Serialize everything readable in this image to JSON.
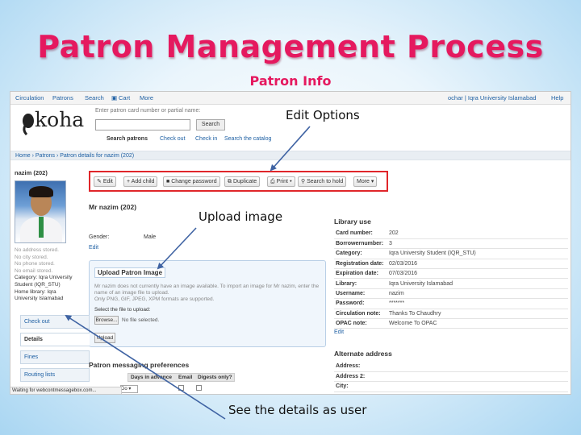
{
  "slide": {
    "title": "Patron Management Process",
    "subtitle": "Patron Info"
  },
  "annotations": {
    "edit_options": "Edit Options",
    "upload_image": "Upload image",
    "see_details": "See the details as user"
  },
  "app": {
    "nav": {
      "items": [
        "Circulation",
        "Patrons",
        "Search",
        "Cart",
        "More"
      ],
      "user": "ochar | Iqra University Islamabad",
      "help": "Help"
    },
    "logo_text": "koha",
    "search": {
      "hint": "Enter patron card number or partial name:",
      "submit_label": "Search",
      "tabs": [
        "Search patrons",
        "Check out",
        "Check in",
        "Search the catalog"
      ]
    },
    "breadcrumb": "Home › Patrons › Patron details for nazim (202)",
    "patron_heading": "nazim (202)",
    "toolbar": [
      "Edit",
      "Add child",
      "Change password",
      "Duplicate",
      "Print",
      "Search to hold",
      "More"
    ],
    "patron_name": "Mr nazim (202)",
    "left_info": [
      "No address stored.",
      "No city stored.",
      "No phone stored.",
      "No email stored.",
      "Category: Iqra University",
      "Student (IQR_STU)",
      "Home library: Iqra",
      "University Islamabad"
    ],
    "gender_label": "Gender:",
    "gender_value": "Male",
    "edit_label": "Edit",
    "upload": {
      "title": "Upload Patron Image",
      "desc": [
        "Mr nazim does not currently have an image available. To import an image for Mr nazim, enter the",
        "name of an image file to upload.",
        "Only PNG, GIF, JPEG, XPM formats are supported."
      ],
      "file_label": "Select the file to upload:",
      "browse_label": "Browse...",
      "file_value": "No file selected.",
      "upload_label": "Upload"
    },
    "library_use": {
      "title": "Library use",
      "rows": [
        {
          "label": "Card number:",
          "value": "202"
        },
        {
          "label": "Borrowernumber:",
          "value": "3"
        },
        {
          "label": "Category:",
          "value": "Iqra University Student (IQR_STU)"
        },
        {
          "label": "Registration date:",
          "value": "02/03/2016"
        },
        {
          "label": "Expiration date:",
          "value": "07/03/2016"
        },
        {
          "label": "Library:",
          "value": "Iqra University Islamabad"
        },
        {
          "label": "Username:",
          "value": "nazim"
        },
        {
          "label": "Password:",
          "value": "*******"
        },
        {
          "label": "Circulation note:",
          "value": "Thanks To Chaudhry"
        },
        {
          "label": "OPAC note:",
          "value": "Welcome To OPAC"
        }
      ]
    },
    "edit_label2": "Edit",
    "alternate": {
      "title": "Alternate address",
      "rows": [
        "Address:",
        "Address 2:",
        "City:"
      ]
    },
    "side_tabs": [
      "Check out",
      "Details",
      "Fines",
      "Routing lists"
    ],
    "messaging": {
      "title": "Patron messaging preferences",
      "headers": [
        "Days in advance",
        "Email",
        "Digests only?"
      ],
      "select_value": "Do"
    },
    "status_bar": "Waiting for webcontmessagebox.com..."
  },
  "colors": {
    "title": "#e5195f",
    "highlight_border": "#e0262a",
    "arrow": "#3f63a3",
    "link": "#1d5fa3"
  }
}
